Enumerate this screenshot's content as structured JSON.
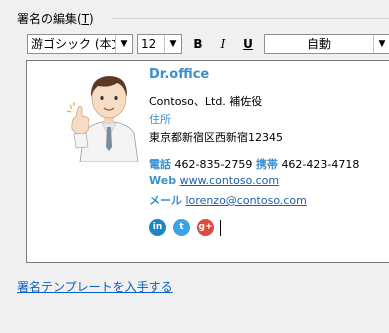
{
  "section": {
    "title": "署名の編集(",
    "accel": "T",
    "title_end": ")"
  },
  "toolbar": {
    "font": "游ゴシック (本文の",
    "size": "12",
    "bold": "B",
    "italic": "I",
    "underline": "U",
    "color": "自動"
  },
  "signature": {
    "name": "Dr.office",
    "company": "Contoso、Ltd. 補佐役",
    "address_label": "住所",
    "address": "東京都新宿区西新宿12345",
    "phone_label": "電話",
    "phone": "462-835-2759",
    "mobile_label": "携帯",
    "mobile": "462-423-4718",
    "web_label": "Web",
    "web": "www.contoso.com",
    "mail_label": "メール",
    "mail": "lorenzo@contoso.com",
    "social": {
      "linkedin": "in",
      "twitter": "t",
      "googleplus": "g+"
    }
  },
  "footer": {
    "link": "署名テンプレートを入手する"
  },
  "colors": {
    "accent": "#3a8fcf",
    "link": "#1f5fb0"
  }
}
